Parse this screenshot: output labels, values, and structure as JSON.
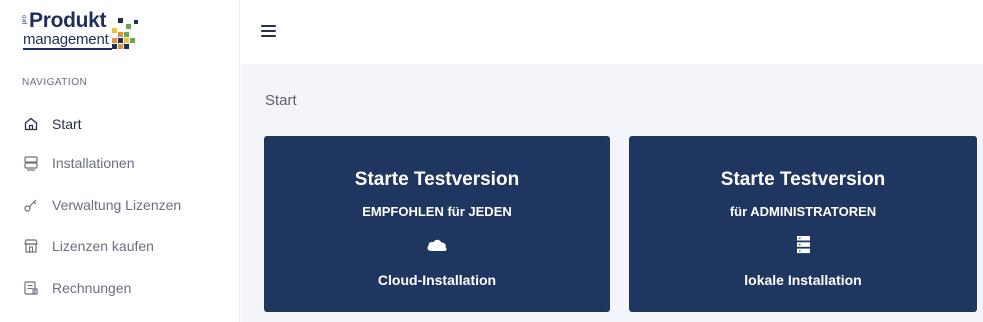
{
  "logo": {
    "pro": "pro",
    "word1": "Produkt",
    "word2": "management"
  },
  "colors": {
    "brand": "#1f2f5c",
    "card": "#1f3760",
    "content_bg": "#f4f5fa"
  },
  "sidebar": {
    "heading": "NAVIGATION",
    "items": [
      {
        "label": "Start",
        "icon": "home-icon",
        "active": true
      },
      {
        "label": "Installationen",
        "icon": "server-icon",
        "active": false
      },
      {
        "label": "Verwaltung Lizenzen",
        "icon": "key-icon",
        "active": false
      },
      {
        "label": "Lizenzen kaufen",
        "icon": "store-icon",
        "active": false
      },
      {
        "label": "Rechnungen",
        "icon": "invoice-icon",
        "active": false
      }
    ]
  },
  "header": {
    "menu_icon": "hamburger-icon"
  },
  "main": {
    "title": "Start",
    "cards": [
      {
        "title": "Starte Testversion",
        "subtitle": "EMPFOHLEN für JEDEN",
        "icon": "cloud-icon",
        "caption": "Cloud-Installation"
      },
      {
        "title": "Starte Testversion",
        "subtitle": "für ADMINISTRATOREN",
        "icon": "server-stack-icon",
        "caption": "lokale Installation"
      }
    ]
  }
}
